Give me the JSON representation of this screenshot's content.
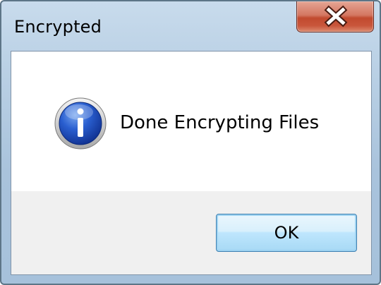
{
  "window": {
    "title": "Encrypted"
  },
  "title_bar": {
    "close_icon": "close-x-icon"
  },
  "message": {
    "icon": "information-icon",
    "text": "Done Encrypting Files"
  },
  "buttons": {
    "ok_label": "OK"
  },
  "colors": {
    "frame": "#a9c3dc",
    "close_button": "#c9563b",
    "ok_button_border": "#3c7fb1",
    "info_icon_blue": "#1f48b8"
  }
}
